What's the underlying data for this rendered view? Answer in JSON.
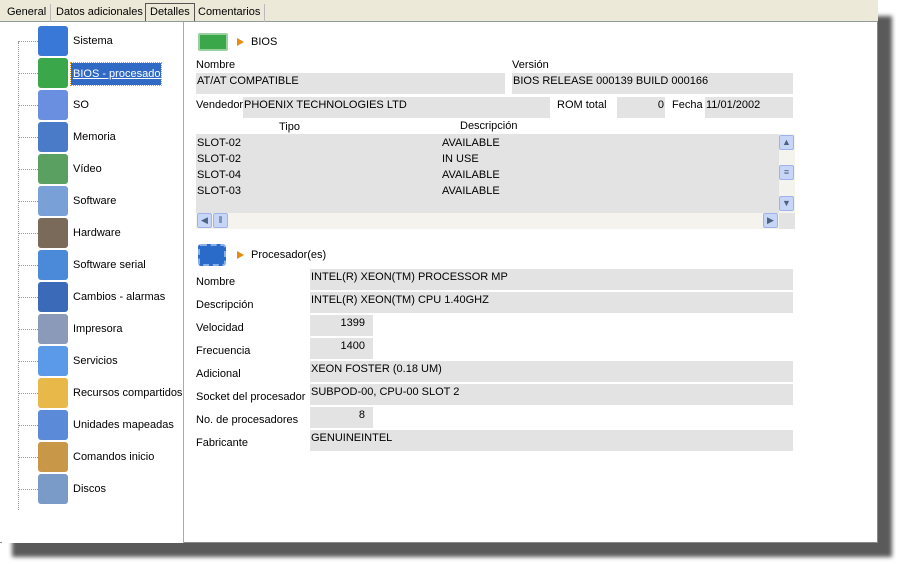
{
  "tabs": [
    {
      "label": "General"
    },
    {
      "label": "Datos adicionales"
    },
    {
      "label": "Detalles",
      "active": true
    },
    {
      "label": "Comentarios"
    }
  ],
  "tree": [
    {
      "label": "Sistema",
      "icon": "monitor-icon",
      "color": "#3a78d8"
    },
    {
      "label": "BIOS - procesador",
      "icon": "circuit-board-icon",
      "color": "#3aa84a",
      "selected": true
    },
    {
      "label": "SO",
      "icon": "os-icon",
      "color": "#6a8ee0"
    },
    {
      "label": "Memoria",
      "icon": "memory-icon",
      "color": "#4a7bc8"
    },
    {
      "label": "Vídeo",
      "icon": "video-icon",
      "color": "#5aa060"
    },
    {
      "label": "Software",
      "icon": "software-icon",
      "color": "#7aa0d8"
    },
    {
      "label": "Hardware",
      "icon": "hardware-icon",
      "color": "#7a6a5a"
    },
    {
      "label": "Software serial",
      "icon": "serial-icon",
      "color": "#4a8ad8"
    },
    {
      "label": "Cambios - alarmas",
      "icon": "alarm-icon",
      "color": "#3a6ab8"
    },
    {
      "label": "Impresora",
      "icon": "printer-icon",
      "color": "#8a9ab8"
    },
    {
      "label": "Servicios",
      "icon": "gears-icon",
      "color": "#5a9ae8"
    },
    {
      "label": "Recursos compartidos",
      "icon": "shared-folder-icon",
      "color": "#e8b848"
    },
    {
      "label": "Unidades mapeadas",
      "icon": "mapped-drive-icon",
      "color": "#5a8ad8"
    },
    {
      "label": "Comandos inicio",
      "icon": "startup-icon",
      "color": "#c89848"
    },
    {
      "label": "Discos",
      "icon": "disk-icon",
      "color": "#7a9ac8"
    }
  ],
  "bios": {
    "title": "BIOS",
    "nombre_label": "Nombre",
    "nombre": "AT/AT COMPATIBLE",
    "version_label": "Versión",
    "version": "BIOS RELEASE 000139 BUILD 000166",
    "vendedor_label": "Vendedor",
    "vendedor": "PHOENIX TECHNOLOGIES LTD",
    "rom_label": "ROM total",
    "rom": "0",
    "fecha_label": "Fecha",
    "fecha": "11/01/2002",
    "table": {
      "headers": [
        "Tipo",
        "Descripción"
      ],
      "rows": [
        [
          "SLOT-02",
          "AVAILABLE"
        ],
        [
          "SLOT-02",
          "IN USE"
        ],
        [
          "SLOT-04",
          "AVAILABLE"
        ],
        [
          "SLOT-03",
          "AVAILABLE"
        ]
      ]
    }
  },
  "cpu": {
    "title": "Procesador(es)",
    "fields": [
      {
        "label": "Nombre",
        "value": "INTEL(R) XEON(TM) PROCESSOR MP",
        "narrow": false
      },
      {
        "label": "Descripción",
        "value": "INTEL(R) XEON(TM) CPU 1.40GHZ",
        "narrow": false
      },
      {
        "label": "Velocidad",
        "value": "1399",
        "narrow": true
      },
      {
        "label": "Frecuencia",
        "value": "1400",
        "narrow": true
      },
      {
        "label": "Adicional",
        "value": "XEON FOSTER (0.18 UM)",
        "narrow": false
      },
      {
        "label": "Socket del procesador",
        "value": "SUBPOD-00, CPU-00 SLOT 2",
        "narrow": false
      },
      {
        "label": "No. de procesadores",
        "value": "8",
        "narrow": true
      },
      {
        "label": "Fabricante",
        "value": "GENUINEINTEL",
        "narrow": false
      }
    ]
  }
}
